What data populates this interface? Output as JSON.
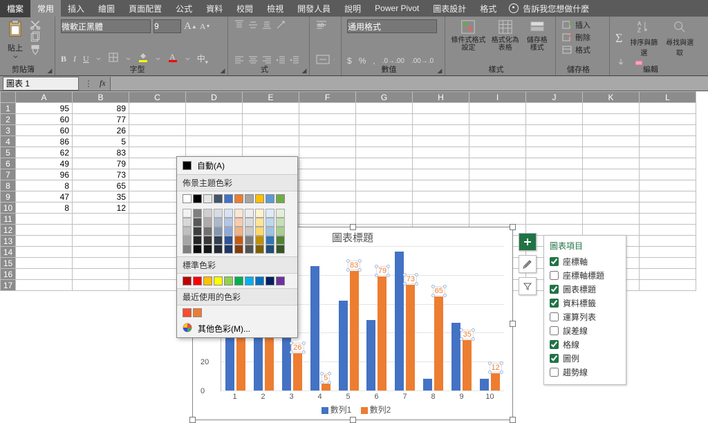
{
  "tabs": {
    "file": "檔案",
    "home": "常用",
    "insert": "插入",
    "draw": "繪圖",
    "page_layout": "頁面配置",
    "formulas": "公式",
    "data": "資料",
    "review": "校閱",
    "view": "檢視",
    "developer": "開發人員",
    "help": "說明",
    "power_pivot": "Power Pivot",
    "chart_design": "圖表設計",
    "format": "格式",
    "tell_me": "告訴我您想做什麼"
  },
  "ribbon": {
    "clipboard": {
      "label": "剪貼簿",
      "paste": "貼上"
    },
    "font": {
      "label": "字型",
      "name": "微軟正黑體",
      "size": "9"
    },
    "alignment": {
      "label": "式"
    },
    "number": {
      "label": "數值",
      "format": "通用格式"
    },
    "styles": {
      "label": "樣式",
      "cond": "條件式格式設定",
      "table": "格式化為表格",
      "cell": "儲存格樣式"
    },
    "cells": {
      "label": "儲存格",
      "insert": "插入",
      "delete": "刪除",
      "format": "格式"
    },
    "editing": {
      "label": "編輯",
      "sort": "排序與篩選",
      "find": "尋找與選取"
    }
  },
  "color_dd": {
    "auto": "自動(A)",
    "theme": "佈景主題色彩",
    "standard": "標準色彩",
    "recent": "最近使用的色彩",
    "more": "其他色彩(M)...",
    "theme_head": [
      "#ffffff",
      "#000000",
      "#e7e6e6",
      "#44546a",
      "#4472c4",
      "#ed7d31",
      "#a5a5a5",
      "#ffc000",
      "#5b9bd5",
      "#70ad47"
    ],
    "theme_rows": [
      [
        "#f2f2f2",
        "#7f7f7f",
        "#d0cece",
        "#d6dce4",
        "#d9e2f3",
        "#fbe5d5",
        "#ededed",
        "#fff2cc",
        "#deebf6",
        "#e2efd9"
      ],
      [
        "#d8d8d8",
        "#595959",
        "#aeabab",
        "#adb9ca",
        "#b4c6e7",
        "#f7cbac",
        "#dbdbdb",
        "#fee599",
        "#bdd7ee",
        "#c5e0b3"
      ],
      [
        "#bfbfbf",
        "#3f3f3f",
        "#757070",
        "#8496b0",
        "#8eaadb",
        "#f4b183",
        "#c9c9c9",
        "#ffd965",
        "#9cc3e5",
        "#a8d08d"
      ],
      [
        "#a5a5a5",
        "#262626",
        "#3a3838",
        "#323f4f",
        "#2f5496",
        "#c55a11",
        "#7b7b7b",
        "#bf9000",
        "#2e75b5",
        "#538135"
      ],
      [
        "#7f7f7f",
        "#0c0c0c",
        "#171616",
        "#222a35",
        "#1f3864",
        "#833c0b",
        "#525252",
        "#7f6000",
        "#1e4e79",
        "#375623"
      ]
    ],
    "standard_row": [
      "#c00000",
      "#ff0000",
      "#ffc000",
      "#ffff00",
      "#92d050",
      "#00b050",
      "#00b0f0",
      "#0070c0",
      "#002060",
      "#7030a0"
    ],
    "recent_row": [
      "#ff4b2b",
      "#ed7d31"
    ]
  },
  "namebox": "圖表 1",
  "columns": [
    "A",
    "B",
    "C",
    "D",
    "E",
    "F",
    "G",
    "H",
    "I",
    "J",
    "K",
    "L"
  ],
  "rows": [
    {
      "n": "1",
      "a": "95",
      "b": "89"
    },
    {
      "n": "2",
      "a": "60",
      "b": "77"
    },
    {
      "n": "3",
      "a": "60",
      "b": "26"
    },
    {
      "n": "4",
      "a": "86",
      "b": "5"
    },
    {
      "n": "5",
      "a": "62",
      "b": "83"
    },
    {
      "n": "6",
      "a": "49",
      "b": "79"
    },
    {
      "n": "7",
      "a": "96",
      "b": "73"
    },
    {
      "n": "8",
      "a": "8",
      "b": "65"
    },
    {
      "n": "9",
      "a": "47",
      "b": "35"
    },
    {
      "n": "10",
      "a": "8",
      "b": "12"
    }
  ],
  "blank_rows": [
    "11",
    "12",
    "13",
    "14",
    "15",
    "16",
    "17"
  ],
  "chart_panel": {
    "title": "圖表項目",
    "items": [
      {
        "label": "座標軸",
        "checked": true
      },
      {
        "label": "座標軸標題",
        "checked": false
      },
      {
        "label": "圖表標題",
        "checked": true
      },
      {
        "label": "資料標籤",
        "checked": true
      },
      {
        "label": "運算列表",
        "checked": false
      },
      {
        "label": "誤差線",
        "checked": false
      },
      {
        "label": "格線",
        "checked": true
      },
      {
        "label": "圖例",
        "checked": true
      },
      {
        "label": "趨勢線",
        "checked": false
      }
    ]
  },
  "chart_data": {
    "type": "bar",
    "title": "圖表標題",
    "categories": [
      "1",
      "2",
      "3",
      "4",
      "5",
      "6",
      "7",
      "8",
      "9",
      "10"
    ],
    "series": [
      {
        "name": "數列1",
        "color": "#4472c4",
        "values": [
          95,
          60,
          60,
          86,
          62,
          49,
          96,
          8,
          47,
          8
        ]
      },
      {
        "name": "數列2",
        "color": "#ed7d31",
        "values": [
          89,
          77,
          26,
          5,
          83,
          79,
          73,
          65,
          35,
          12
        ]
      }
    ],
    "ylim": [
      0,
      100
    ],
    "yticks": [
      0,
      20,
      40,
      60,
      80,
      100
    ],
    "ylabel": "",
    "xlabel": "",
    "data_labels_series": 1
  }
}
